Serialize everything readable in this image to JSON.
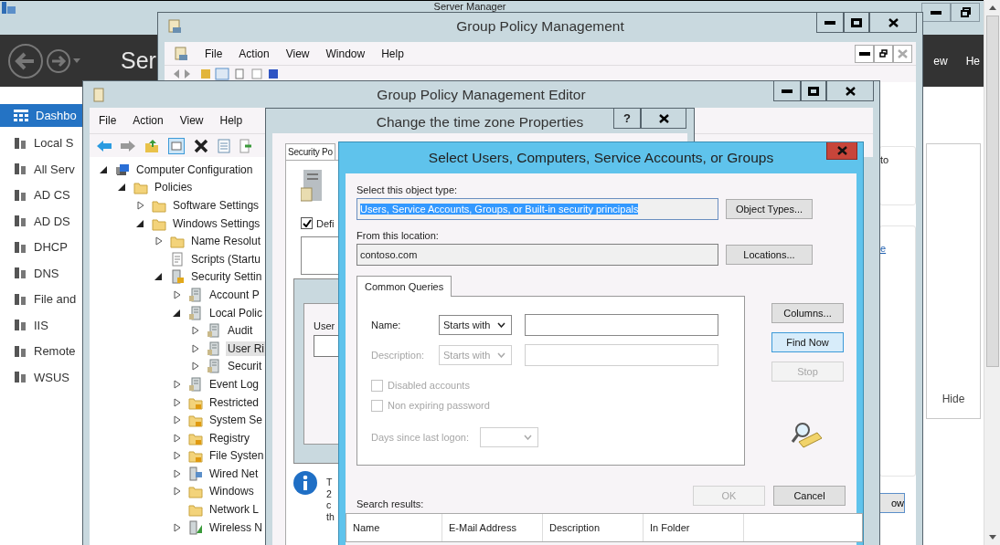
{
  "server_manager": {
    "title": "Server Manager",
    "heading": "Ser",
    "menu": [
      "ew",
      "He"
    ],
    "sidebar": [
      {
        "label": "Dashbo",
        "selected": true
      },
      {
        "label": "Local S",
        "selected": false
      },
      {
        "label": "All Serv",
        "selected": false
      },
      {
        "label": "AD CS",
        "selected": false
      },
      {
        "label": "AD DS",
        "selected": false
      },
      {
        "label": "DHCP",
        "selected": false
      },
      {
        "label": "DNS",
        "selected": false
      },
      {
        "label": "File and",
        "selected": false
      },
      {
        "label": "IIS",
        "selected": false
      },
      {
        "label": "Remote",
        "selected": false
      },
      {
        "label": "WSUS",
        "selected": false
      }
    ],
    "hide_button": "Hide"
  },
  "gpm": {
    "title": "Group Policy Management",
    "menu": [
      "File",
      "Action",
      "View",
      "Window",
      "Help"
    ],
    "tile_text": "to",
    "link": "e",
    "button": "ow"
  },
  "gpme": {
    "title": "Group Policy Management Editor",
    "menu": [
      "File",
      "Action",
      "View",
      "Help"
    ],
    "tree": [
      {
        "label": "Computer Configuration",
        "kind": "computer",
        "expandable": true,
        "expanded": true,
        "selected": false,
        "children": [
          {
            "label": "Policies",
            "kind": "folder",
            "expandable": true,
            "expanded": true,
            "selected": false,
            "children": [
              {
                "label": "Software Settings",
                "kind": "folder",
                "expandable": true,
                "expanded": false,
                "selected": false
              },
              {
                "label": "Windows Settings",
                "kind": "folder",
                "expandable": true,
                "expanded": true,
                "selected": false,
                "children": [
                  {
                    "label": "Name Resolut",
                    "kind": "folder",
                    "expandable": true,
                    "expanded": false,
                    "selected": false
                  },
                  {
                    "label": "Scripts (Startu",
                    "kind": "script",
                    "expandable": false,
                    "expanded": false,
                    "selected": false
                  },
                  {
                    "label": "Security Settin",
                    "kind": "security",
                    "expandable": true,
                    "expanded": true,
                    "selected": false,
                    "children": [
                      {
                        "label": "Account P",
                        "kind": "policy",
                        "expandable": true,
                        "expanded": false,
                        "selected": false
                      },
                      {
                        "label": "Local Polic",
                        "kind": "policy",
                        "expandable": true,
                        "expanded": true,
                        "selected": false,
                        "children": [
                          {
                            "label": "Audit",
                            "kind": "policy",
                            "expandable": true,
                            "expanded": false,
                            "selected": false
                          },
                          {
                            "label": "User Ri",
                            "kind": "policy",
                            "expandable": true,
                            "expanded": false,
                            "selected": true
                          },
                          {
                            "label": "Securit",
                            "kind": "policy",
                            "expandable": true,
                            "expanded": false,
                            "selected": false
                          }
                        ]
                      },
                      {
                        "label": "Event Log",
                        "kind": "policy",
                        "expandable": true,
                        "expanded": false,
                        "selected": false
                      },
                      {
                        "label": "Restricted",
                        "kind": "lockfolder",
                        "expandable": true,
                        "expanded": false,
                        "selected": false
                      },
                      {
                        "label": "System Se",
                        "kind": "lockfolder",
                        "expandable": true,
                        "expanded": false,
                        "selected": false
                      },
                      {
                        "label": "Registry",
                        "kind": "lockfolder",
                        "expandable": true,
                        "expanded": false,
                        "selected": false
                      },
                      {
                        "label": "File Systen",
                        "kind": "lockfolder",
                        "expandable": true,
                        "expanded": false,
                        "selected": false
                      },
                      {
                        "label": "Wired Net",
                        "kind": "network",
                        "expandable": true,
                        "expanded": false,
                        "selected": false
                      },
                      {
                        "label": "Windows",
                        "kind": "folder",
                        "expandable": true,
                        "expanded": false,
                        "selected": false
                      },
                      {
                        "label": "Network L",
                        "kind": "folder",
                        "expandable": false,
                        "expanded": false,
                        "selected": false
                      },
                      {
                        "label": "Wireless N",
                        "kind": "wireless",
                        "expandable": true,
                        "expanded": false,
                        "selected": false
                      }
                    ]
                  }
                ]
              }
            ]
          }
        ]
      }
    ]
  },
  "properties": {
    "title": "Change the time zone Properties",
    "help_button": "?",
    "tab": "Security Po",
    "define_checkbox": {
      "label": "Defi",
      "checked": true
    },
    "users_label": "User",
    "info_lines": [
      "T",
      "2",
      "c",
      "th"
    ]
  },
  "select_dialog": {
    "title": "Select Users, Computers, Service Accounts, or Groups",
    "object_type_label": "Select this object type:",
    "object_type_value": "Users, Service Accounts, Groups, or Built-in security principals",
    "object_types_button": "Object Types...",
    "location_label": "From this location:",
    "location_value": "contoso.com",
    "locations_button": "Locations...",
    "tab": "Common Queries",
    "query_rows": [
      {
        "label": "Name:",
        "operator": "Starts with",
        "disabled": false
      },
      {
        "label": "Description:",
        "operator": "Starts with",
        "disabled": true
      }
    ],
    "checkboxes": [
      {
        "label": "Disabled accounts",
        "checked": false,
        "disabled": true
      },
      {
        "label": "Non expiring password",
        "checked": false,
        "disabled": true
      }
    ],
    "days_label": "Days since last logon:",
    "side_buttons": [
      {
        "label": "Columns...",
        "disabled": false,
        "default": false
      },
      {
        "label": "Find Now",
        "disabled": false,
        "default": true
      },
      {
        "label": "Stop",
        "disabled": true,
        "default": false
      }
    ],
    "bottom_buttons": [
      {
        "label": "OK",
        "disabled": true,
        "default": false
      },
      {
        "label": "Cancel",
        "disabled": false,
        "default": false
      }
    ],
    "results_label": "Search results:",
    "columns": [
      "Name",
      "E-Mail Address",
      "Description",
      "In Folder"
    ]
  }
}
